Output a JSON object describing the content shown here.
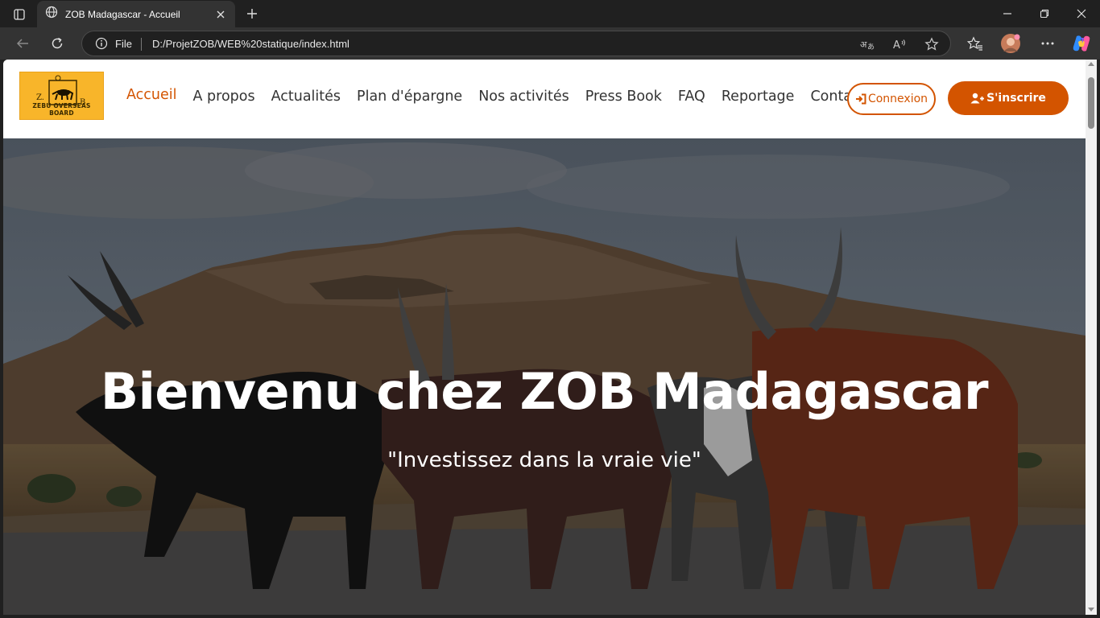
{
  "browser": {
    "tab_title": "ZOB Madagascar - Accueil",
    "address_scheme": "File",
    "address_url": "D:/ProjetZOB/WEB%20statique/index.html",
    "icons": [
      "tab-actions-icon",
      "globe-icon",
      "close-icon",
      "plus-icon",
      "minimize-icon",
      "restore-icon",
      "close-window-icon",
      "back-icon",
      "refresh-icon",
      "info-icon",
      "translate-icon",
      "read-aloud-icon",
      "star-icon",
      "favorites-icon",
      "avatar",
      "more-icon",
      "copilot-icon"
    ]
  },
  "site": {
    "logo": {
      "text": "ZEBU OVERSEAS BOARD",
      "letters": [
        "Z.",
        "O",
        "B."
      ],
      "bg_color": "#f8b52a"
    },
    "nav": [
      {
        "label": "Accueil",
        "active": true
      },
      {
        "label": "A propos"
      },
      {
        "label": "Actualités"
      },
      {
        "label": "Plan d'épargne"
      },
      {
        "label": "Nos activités"
      },
      {
        "label": "Press Book"
      },
      {
        "label": "FAQ"
      },
      {
        "label": "Reportage"
      },
      {
        "label": "Contact"
      }
    ],
    "login_label": "Connexion",
    "signup_label": "S'inscrire",
    "accent_color": "#d35400"
  },
  "hero": {
    "title": "Bienvenu chez ZOB Madagascar",
    "subtitle": "\"Investissez dans la vraie vie\""
  }
}
